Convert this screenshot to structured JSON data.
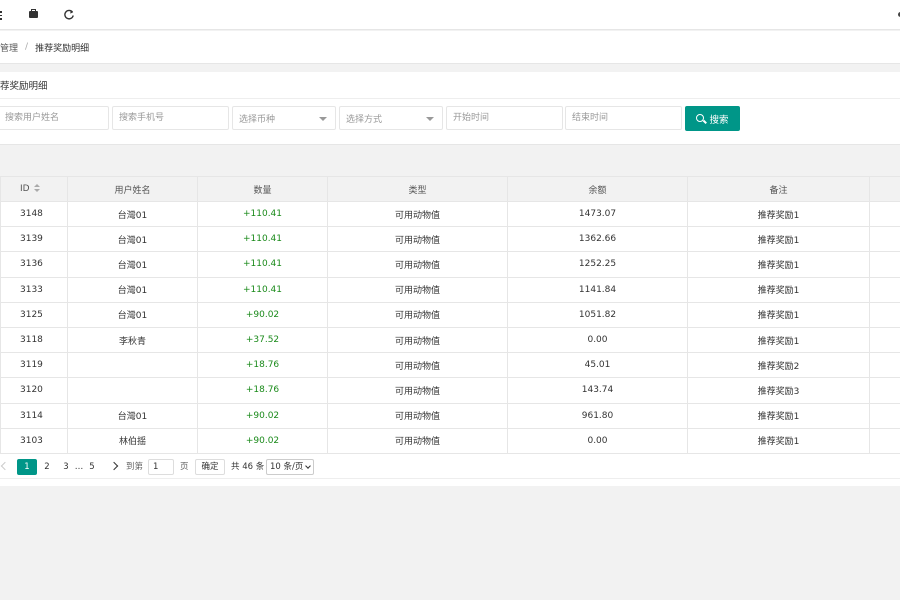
{
  "topbar": {
    "menu_icon": "menu-icon",
    "bag_icon": "briefcase-icon",
    "refresh_icon": "refresh-icon"
  },
  "breadcrumb": {
    "parent": "管理",
    "separator": "/",
    "current": "推荐奖励明细"
  },
  "panel": {
    "title": "荐奖励明细"
  },
  "filters": {
    "username_placeholder": "搜索用户姓名",
    "phone_placeholder": "搜索手机号",
    "currency_select": "选择币种",
    "method_select": "选择方式",
    "start_placeholder": "开始时间",
    "end_placeholder": "结束时间",
    "search_label": "搜索"
  },
  "table": {
    "columns": [
      "ID",
      "用户姓名",
      "数量",
      "类型",
      "余额",
      "备注"
    ],
    "rows": [
      {
        "id": "3148",
        "name": "台灣01",
        "amount": "+110.41",
        "type": "可用动物值",
        "balance": "1473.07",
        "note": "推荐奖励1"
      },
      {
        "id": "3139",
        "name": "台灣01",
        "amount": "+110.41",
        "type": "可用动物值",
        "balance": "1362.66",
        "note": "推荐奖励1"
      },
      {
        "id": "3136",
        "name": "台灣01",
        "amount": "+110.41",
        "type": "可用动物值",
        "balance": "1252.25",
        "note": "推荐奖励1"
      },
      {
        "id": "3133",
        "name": "台灣01",
        "amount": "+110.41",
        "type": "可用动物值",
        "balance": "1141.84",
        "note": "推荐奖励1"
      },
      {
        "id": "3125",
        "name": "台灣01",
        "amount": "+90.02",
        "type": "可用动物值",
        "balance": "1051.82",
        "note": "推荐奖励1"
      },
      {
        "id": "3118",
        "name": "李秋青",
        "amount": "+37.52",
        "type": "可用动物值",
        "balance": "0.00",
        "note": "推荐奖励1"
      },
      {
        "id": "3119",
        "name": "",
        "amount": "+18.76",
        "type": "可用动物值",
        "balance": "45.01",
        "note": "推荐奖励2"
      },
      {
        "id": "3120",
        "name": "",
        "amount": "+18.76",
        "type": "可用动物值",
        "balance": "143.74",
        "note": "推荐奖励3"
      },
      {
        "id": "3114",
        "name": "台灣01",
        "amount": "+90.02",
        "type": "可用动物值",
        "balance": "961.80",
        "note": "推荐奖励1"
      },
      {
        "id": "3103",
        "name": "林伯揺",
        "amount": "+90.02",
        "type": "可用动物值",
        "balance": "0.00",
        "note": "推荐奖励1"
      }
    ]
  },
  "pager": {
    "page1": "1",
    "page2": "2",
    "page3": "3",
    "ellipsis": "…",
    "page_last": "5",
    "goto": "到第",
    "goto_value": "1",
    "page_unit": "页",
    "confirm": "确定",
    "total": "共 46 条",
    "page_size": "10 条/页"
  },
  "colors": {
    "accent": "#009688",
    "positive": "#1a8a1a"
  }
}
